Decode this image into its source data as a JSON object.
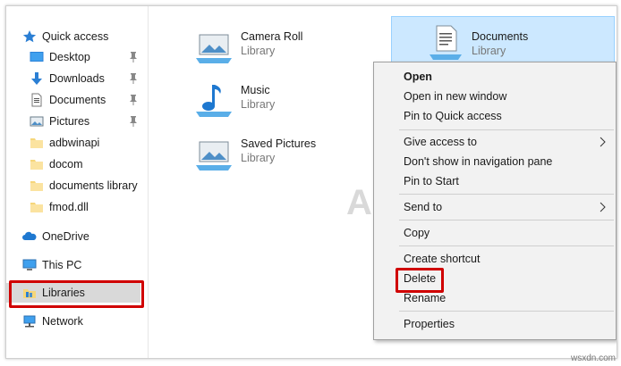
{
  "nav": {
    "quick_access": "Quick access",
    "items": [
      {
        "label": "Desktop",
        "pinned": true,
        "icon": "desktop-icon"
      },
      {
        "label": "Downloads",
        "pinned": true,
        "icon": "download-icon"
      },
      {
        "label": "Documents",
        "pinned": true,
        "icon": "document-icon"
      },
      {
        "label": "Pictures",
        "pinned": true,
        "icon": "pictures-icon"
      },
      {
        "label": "adbwinapi",
        "pinned": false,
        "icon": "folder-icon"
      },
      {
        "label": "docom",
        "pinned": false,
        "icon": "folder-icon"
      },
      {
        "label": "documents library",
        "pinned": false,
        "icon": "folder-icon"
      },
      {
        "label": "fmod.dll",
        "pinned": false,
        "icon": "folder-icon"
      }
    ],
    "onedrive": "OneDrive",
    "this_pc": "This PC",
    "libraries": "Libraries",
    "network": "Network"
  },
  "libraries": [
    {
      "name": "Camera Roll",
      "sub": "Library"
    },
    {
      "name": "Music",
      "sub": "Library"
    },
    {
      "name": "Saved Pictures",
      "sub": "Library"
    },
    {
      "name": "Documents",
      "sub": "Library"
    }
  ],
  "context_menu": {
    "open": "Open",
    "open_new_window": "Open in new window",
    "pin_quick_access": "Pin to Quick access",
    "give_access": "Give access to",
    "dont_show": "Don't show in navigation pane",
    "pin_start": "Pin to Start",
    "send_to": "Send to",
    "copy": "Copy",
    "create_shortcut": "Create shortcut",
    "delete": "Delete",
    "rename": "Rename",
    "properties": "Properties"
  },
  "watermark": "A PUALS",
  "corner_watermark": "wsxdn.com",
  "colors": {
    "highlight_red": "#d00000",
    "selection": "#cce8ff",
    "accent_blue": "#1e78d0"
  }
}
